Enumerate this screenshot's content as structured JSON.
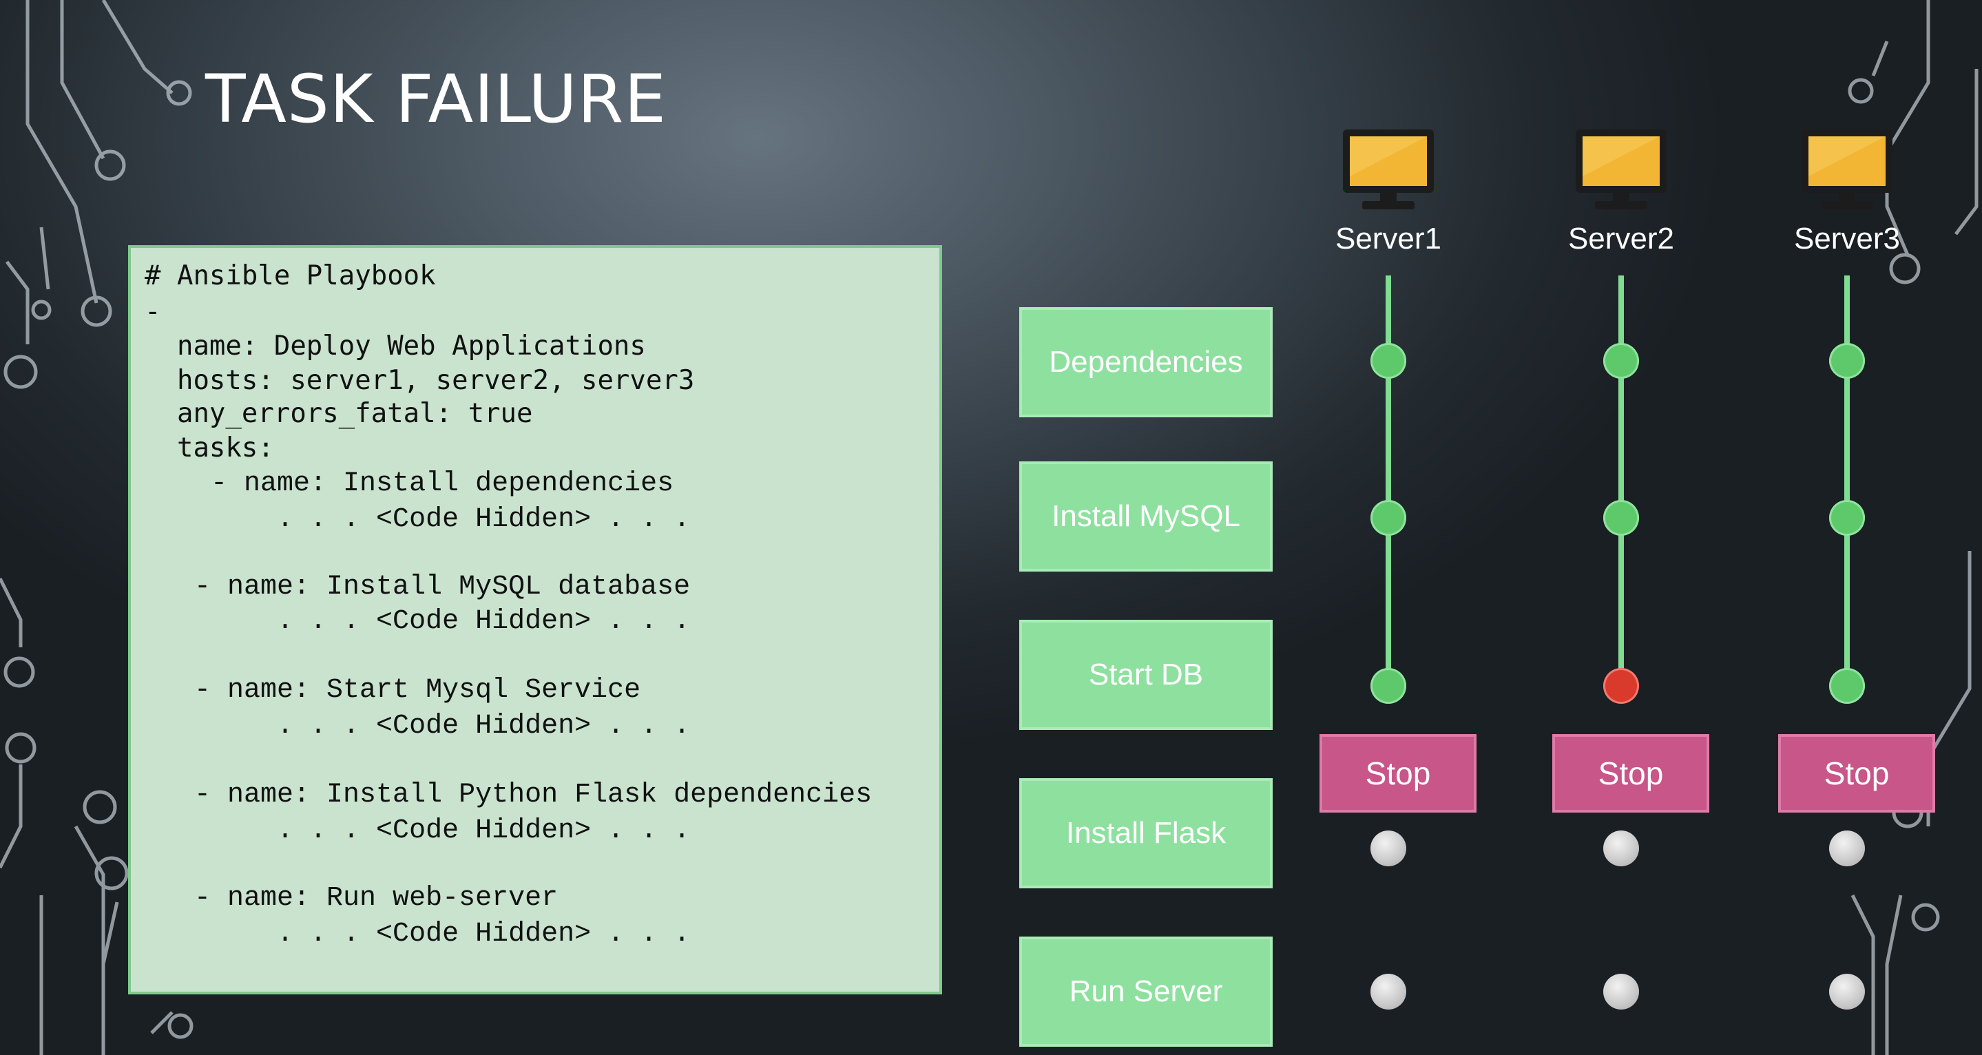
{
  "title": "TASK FAILURE",
  "playbook": [
    {
      "text": "# Ansible Playbook",
      "font": "mono"
    },
    {
      "text": "-",
      "font": "mono"
    },
    {
      "text": "  name: Deploy Web Applications",
      "font": "mono"
    },
    {
      "text": "  hosts: server1, server2, server3",
      "font": "mono"
    },
    {
      "text": "  any_errors_fatal: true",
      "font": "mono"
    },
    {
      "text": "  tasks:",
      "font": "mono"
    },
    {
      "text": "    - name: Install dependencies",
      "font": "serifmono"
    },
    {
      "text": "        . . . <Code Hidden> . . .",
      "font": "serifmono"
    },
    {
      "text": "   - name: Install MySQL database",
      "font": "serifmono"
    },
    {
      "text": "        . . . <Code Hidden> . . .",
      "font": "serifmono"
    },
    {
      "text": "   - name: Start Mysql Service",
      "font": "serifmono"
    },
    {
      "text": "        . . . <Code Hidden> . . .",
      "font": "serifmono"
    },
    {
      "text": "   - name: Install Python Flask dependencies",
      "font": "serifmono"
    },
    {
      "text": "        . . . <Code Hidden> . . .",
      "font": "serifmono"
    },
    {
      "text": "   - name: Run web-server",
      "font": "serifmono"
    },
    {
      "text": "        . . . <Code Hidden> . . .",
      "font": "serifmono"
    }
  ],
  "tasks": [
    "Dependencies",
    "Install MySQL",
    "Start DB",
    "Install Flask",
    "Run Server"
  ],
  "servers": [
    {
      "name": "Server1",
      "statuses": [
        "success",
        "success",
        "success",
        "skipped",
        "skipped"
      ],
      "stop_label": "Stop"
    },
    {
      "name": "Server2",
      "statuses": [
        "success",
        "success",
        "failed",
        "skipped",
        "skipped"
      ],
      "stop_label": "Stop"
    },
    {
      "name": "Server3",
      "statuses": [
        "success",
        "success",
        "success",
        "skipped",
        "skipped"
      ],
      "stop_label": "Stop"
    }
  ],
  "colors": {
    "success": "#5dc96b",
    "failed": "#d93a2c",
    "skipped": "#c8c8c8",
    "task_box": "#8ee09f",
    "stop_box": "#c85688",
    "code_bg": "#c9e3cf"
  },
  "icons": {
    "server": "monitor-icon"
  }
}
